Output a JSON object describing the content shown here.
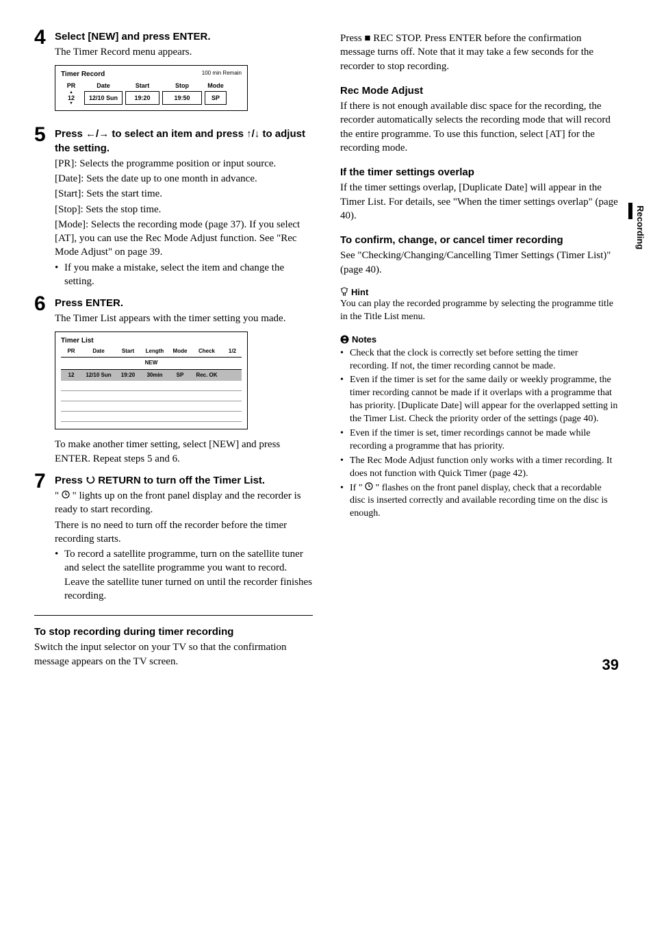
{
  "sideTab": "Recording",
  "pageNumber": "39",
  "left": {
    "step4": {
      "num": "4",
      "head": "Select [NEW] and press ENTER.",
      "sub": "The Timer Record menu appears."
    },
    "timerRecord": {
      "title": "Timer Record",
      "remain": "100 min Remain",
      "h1": "PR",
      "h2": "Date",
      "h3": "Start",
      "h4": "Stop",
      "h5": "Mode",
      "v1": "12",
      "v2": "12/10 Sun",
      "v3": "19:20",
      "v4": "19:50",
      "v5": "SP"
    },
    "step5": {
      "num": "5",
      "headA": "Press ",
      "headArrows": "←/→",
      "headB": " to select an item and press ",
      "headArrows2": "↑/↓",
      "headC": " to adjust the setting.",
      "p1": "[PR]: Selects the programme position or input source.",
      "p2": "[Date]: Sets the date up to one month in advance.",
      "p3": "[Start]: Sets the start time.",
      "p4": "[Stop]: Sets the stop time.",
      "p5a": "[Mode]: Selects the recording mode (page 37). If you select [AT], you can use the Rec Mode Adjust function. See \"Rec Mode Adjust\" on page 39.",
      "b1": "If you make a mistake, select the item and change the setting."
    },
    "step6": {
      "num": "6",
      "head": "Press ENTER.",
      "sub": "The Timer List appears with the timer setting you made."
    },
    "timerList": {
      "title": "Timer List",
      "h1": "PR",
      "h2": "Date",
      "h3": "Start",
      "h4": "Length",
      "h5": "Mode",
      "h6": "Check",
      "h7": "1/2",
      "new": "NEW",
      "r1": "12",
      "r2": "12/10 Sun",
      "r3": "19:20",
      "r4": "30min",
      "r5": "SP",
      "r6": "Rec. OK"
    },
    "step6foot": "To make another timer setting, select [NEW] and press ENTER. Repeat steps 5 and 6.",
    "step7": {
      "num": "7",
      "headA": "Press ",
      "headB": " RETURN to turn off the Timer List.",
      "p1a": "\" ",
      "p1b": " \" lights up on the front panel display and the recorder is ready to start recording.",
      "p2": "There is no need to turn off the recorder before the timer recording starts.",
      "b1": "To record a satellite programme, turn on the satellite tuner and select the satellite programme you want to record. Leave the satellite tuner turned on until the recorder finishes recording."
    },
    "stopHead": "To stop recording during timer recording",
    "stopBody": "Switch the input selector on your TV so that the confirmation message appears on the TV screen."
  },
  "right": {
    "topA": "Press ",
    "topB": " REC STOP. Press ENTER before the confirmation message turns off. Note that it may take a few seconds for the recorder to stop recording.",
    "recHead": "Rec Mode Adjust",
    "recBody": "If there is not enough available disc space for the recording, the recorder automatically selects the recording mode that will record the entire programme. To use this function, select [AT] for the recording mode.",
    "ovHead": "If the timer settings overlap",
    "ovBody": "If the timer settings overlap, [Duplicate Date] will appear in the Timer List. For details, see \"When the timer settings overlap\" (page 40).",
    "confHead": "To confirm, change, or cancel timer recording",
    "confBody": "See \"Checking/Changing/Cancelling Timer Settings (Timer List)\" (page 40).",
    "hintLabel": "Hint",
    "hintBody": "You can play the recorded programme by selecting the programme title in the Title List menu.",
    "notesLabel": "Notes",
    "n1": "Check that the clock is correctly set before setting the timer recording. If not, the timer recording cannot be made.",
    "n2": "Even if the timer is set for the same daily or weekly programme, the timer recording cannot be made if it overlaps with a programme that has priority. [Duplicate Date] will appear for the overlapped setting in the Timer List. Check the priority order of the settings (page 40).",
    "n3": "Even if the timer is set, timer recordings cannot be made while recording a programme that has priority.",
    "n4": "The Rec Mode Adjust function only works with a timer recording. It does not function with Quick Timer (page 42).",
    "n5a": "If \" ",
    "n5b": " \" flashes on the front panel display, check that a recordable disc is inserted correctly and available recording time on the disc is enough."
  }
}
